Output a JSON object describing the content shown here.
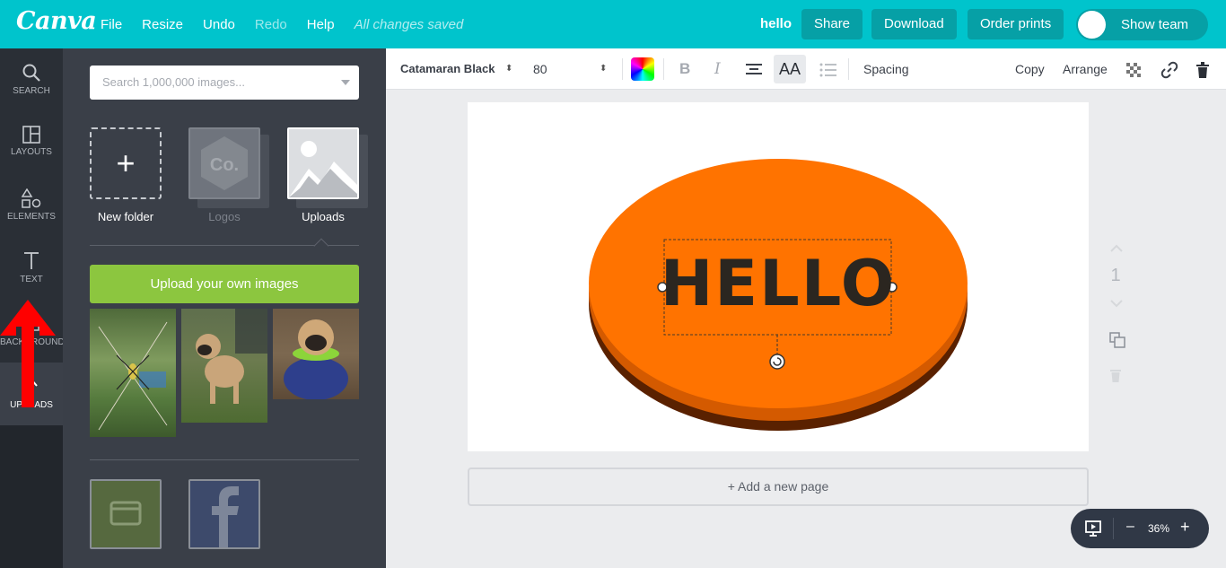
{
  "app": {
    "logo": "Canva"
  },
  "menu": {
    "file": "File",
    "resize": "Resize",
    "undo": "Undo",
    "redo": "Redo",
    "help": "Help",
    "status": "All changes saved"
  },
  "header": {
    "doc_name": "hello",
    "share": "Share",
    "download": "Download",
    "order_prints": "Order prints",
    "show_team": "Show team"
  },
  "sidebar": {
    "items": [
      {
        "label": "SEARCH",
        "icon": "search-icon"
      },
      {
        "label": "LAYOUTS",
        "icon": "layouts-icon"
      },
      {
        "label": "ELEMENTS",
        "icon": "elements-icon"
      },
      {
        "label": "TEXT",
        "icon": "text-icon"
      },
      {
        "label": "BACKGROUND",
        "icon": "background-icon"
      },
      {
        "label": "UPLOADS",
        "icon": "upload-icon"
      }
    ]
  },
  "panel": {
    "search_placeholder": "Search 1,000,000 images...",
    "folders": [
      {
        "label": "New folder"
      },
      {
        "label": "Logos"
      },
      {
        "label": "Uploads"
      }
    ],
    "logo_badge": "Co.",
    "upload_button": "Upload your own images",
    "images": [
      "spider-photo",
      "pug-photo",
      "pug-sweater-photo"
    ],
    "connect": [
      "Purchased",
      "Facebook"
    ]
  },
  "toolbar": {
    "font": "Catamaran Black",
    "size": "80",
    "bold": "B",
    "italic": "I",
    "case": "AA",
    "spacing": "Spacing",
    "copy": "Copy",
    "arrange": "Arrange"
  },
  "canvas": {
    "text": "HELLO",
    "ellipse_color": "#ff7300",
    "shadow_color": "#5a2100",
    "add_page": "+ Add a new page",
    "page_number": "1"
  },
  "zoom": {
    "value": "36%",
    "minus": "–",
    "plus": "+"
  },
  "colors": {
    "brand": "#00c4cc",
    "button": "#06a0a6",
    "upload_green": "#8cc63f",
    "annotation": "#ff0000"
  }
}
